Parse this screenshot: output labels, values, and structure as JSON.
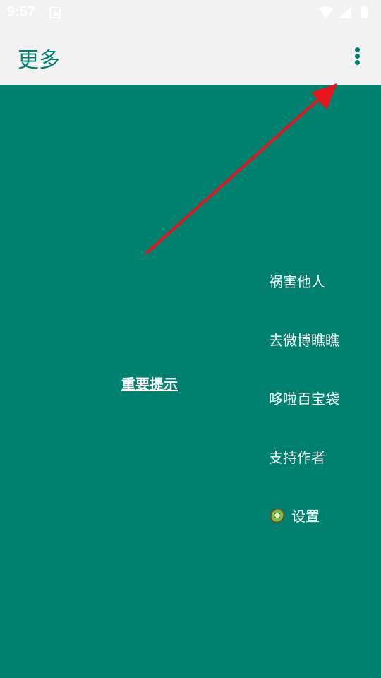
{
  "status_bar": {
    "time": "9:57"
  },
  "app_bar": {
    "title": "更多",
    "overflow_icon": "more-vert-icon"
  },
  "main": {
    "important_link": "重要提示",
    "menu": [
      {
        "label": "祸害他人"
      },
      {
        "label": "去微博瞧瞧"
      },
      {
        "label": "哆啦百宝袋"
      },
      {
        "label": "支持作者"
      },
      {
        "label": "设置",
        "icon": "kiwi-icon"
      }
    ]
  },
  "colors": {
    "primary": "#00806f",
    "bar_background": "#f2f2f2",
    "annotation_arrow": "#e8141c",
    "text_light": "#ffffff"
  }
}
